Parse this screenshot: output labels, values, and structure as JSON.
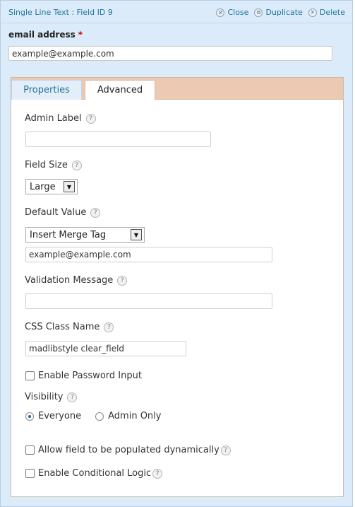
{
  "header": {
    "title": "Single Line Text : Field ID 9",
    "actions": [
      {
        "label": "Close",
        "icon": "close-circle-icon",
        "glyph": "⊘"
      },
      {
        "label": "Duplicate",
        "icon": "duplicate-icon",
        "glyph": "⧉"
      },
      {
        "label": "Delete",
        "icon": "delete-icon",
        "glyph": "✕"
      }
    ]
  },
  "preview": {
    "label": "email address",
    "required_mark": "*",
    "value": "example@example.com"
  },
  "tabs": {
    "properties": "Properties",
    "advanced": "Advanced",
    "active": "Advanced"
  },
  "advanced": {
    "help_glyph": "?",
    "admin_label": {
      "label": "Admin Label",
      "value": ""
    },
    "field_size": {
      "label": "Field Size",
      "selected": "Large"
    },
    "default_value": {
      "label": "Default Value",
      "merge_tag": "Insert Merge Tag",
      "value": "example@example.com"
    },
    "validation_message": {
      "label": "Validation Message",
      "value": ""
    },
    "css_class": {
      "label": "CSS Class Name",
      "value": "madlibstyle clear_field"
    },
    "enable_password": {
      "label": "Enable Password Input",
      "checked": false
    },
    "visibility": {
      "label": "Visibility",
      "options": [
        {
          "label": "Everyone",
          "selected": true
        },
        {
          "label": "Admin Only",
          "selected": false
        }
      ]
    },
    "populate_dynamically": {
      "label": "Allow field to be populated dynamically",
      "checked": false
    },
    "conditional_logic": {
      "label": "Enable Conditional Logic",
      "checked": false
    }
  },
  "colors": {
    "panel_bg": "#dcebfa",
    "link_blue": "#21759b",
    "tab_strip": "#ecc9b2",
    "required_red": "#cc0000"
  }
}
